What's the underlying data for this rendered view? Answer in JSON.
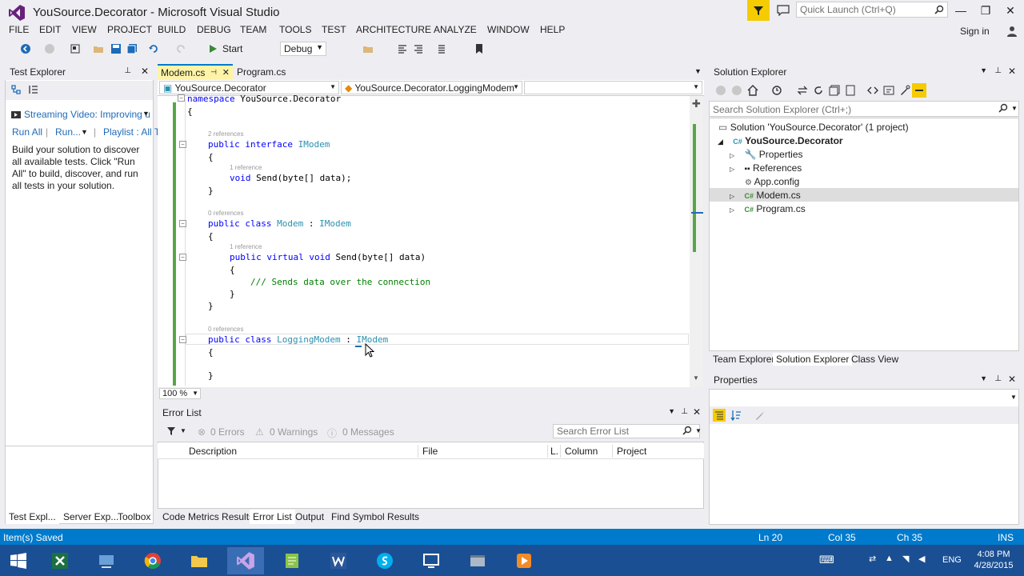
{
  "window": {
    "title": "YouSource.Decorator - Microsoft Visual Studio",
    "quick_launch_placeholder": "Quick Launch (Ctrl+Q)",
    "minimize": "—",
    "restore": "❐",
    "close": "✕"
  },
  "menu": {
    "items": [
      "FILE",
      "EDIT",
      "VIEW",
      "PROJECT",
      "BUILD",
      "DEBUG",
      "TEAM",
      "TOOLS",
      "TEST",
      "ARCHITECTURE",
      "ANALYZE",
      "WINDOW",
      "HELP"
    ],
    "sign_in": "Sign in"
  },
  "toolbar": {
    "start_label": "Start",
    "configuration": "Debug"
  },
  "test_explorer": {
    "title": "Test Explorer",
    "video_link": "Streaming Video: Improving u",
    "run_all": "Run All",
    "run": "Run...",
    "playlist": "Playlist : All T",
    "description": "Build your solution to discover all available tests. Click \"Run All\" to build, discover, and run all tests in your solution."
  },
  "left_tabs": [
    "Test Expl...",
    "Server Exp...",
    "Toolbox"
  ],
  "editor": {
    "tabs": [
      "Modem.cs",
      "Program.cs"
    ],
    "nav_project": "YouSource.Decorator",
    "nav_type": "YouSource.Decorator.LoggingModem",
    "zoom": "100 %",
    "lines": {
      "ns_kw": "namespace",
      "ns_name": " YouSource.Decorator",
      "brace_open": "{",
      "brace_close": "}",
      "ref_2": "2 references",
      "ref_1": "1 reference",
      "ref_0": "0 references",
      "public": "public",
      "interface": "interface",
      "class": "class",
      "virtual": "virtual",
      "void": "void",
      "IModem": "IModem",
      "Modem": "Modem",
      "LoggingModem": "LoggingModem",
      "colon": " : ",
      "send_sig": " Send(byte[] data);",
      "send_sig2": " Send(byte[] data)",
      "comment": "/// Sends data over the connection"
    }
  },
  "error_list": {
    "title": "Error List",
    "errors": "0 Errors",
    "warnings": "0 Warnings",
    "messages": "0 Messages",
    "search_placeholder": "Search Error List",
    "columns": [
      "Description",
      "File",
      "L.",
      "Column",
      "Project"
    ]
  },
  "bottom_tabs": [
    "Code Metrics Results",
    "Error List",
    "Output",
    "Find Symbol Results"
  ],
  "solution_explorer": {
    "title": "Solution Explorer",
    "search_placeholder": "Search Solution Explorer (Ctrl+;)",
    "solution": "Solution 'YouSource.Decorator' (1 project)",
    "project": "YouSource.Decorator",
    "items": [
      "Properties",
      "References",
      "App.config",
      "Modem.cs",
      "Program.cs"
    ],
    "tabs": [
      "Team Explorer",
      "Solution Explorer",
      "Class View"
    ]
  },
  "properties": {
    "title": "Properties"
  },
  "status": {
    "message": "Item(s) Saved",
    "ln": "Ln 20",
    "col": "Col 35",
    "ch": "Ch 35",
    "ins": "INS"
  },
  "taskbar": {
    "lang": "ENG",
    "time": "4:08 PM",
    "date": "4/28/2015"
  },
  "colors": {
    "accent": "#007acc",
    "keyword": "#0000ff",
    "type": "#2b91af",
    "comment": "#008000",
    "change_bar": "#57a64a"
  }
}
